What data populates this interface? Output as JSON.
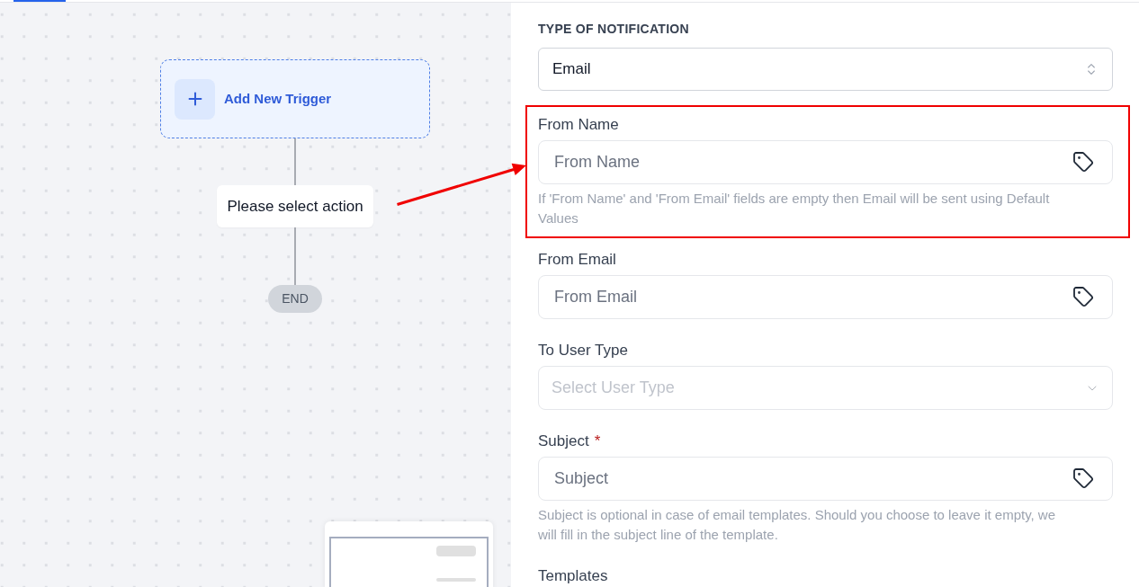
{
  "canvas": {
    "trigger_node": {
      "label": "Add New Trigger"
    },
    "action_node": {
      "label": "Please select action"
    },
    "end_node": {
      "label": "END"
    }
  },
  "panel": {
    "notification_type": {
      "label": "TYPE OF NOTIFICATION",
      "value": "Email"
    },
    "fields": [
      {
        "kind": "text",
        "label": "From Name",
        "placeholder": "From Name",
        "help": "If 'From Name' and 'From Email' fields are empty then Email will be sent using Default Values",
        "highlighted": true
      },
      {
        "kind": "text",
        "label": "From Email",
        "placeholder": "From Email",
        "highlighted": false
      },
      {
        "kind": "select",
        "label": "To User Type",
        "placeholder": "Select User Type",
        "highlighted": false
      },
      {
        "kind": "text",
        "label": "Subject",
        "required_mark": "*",
        "placeholder": "Subject",
        "help": "Subject is optional in case of email templates. Should you choose to leave it empty, we will fill in the subject line of the template.",
        "highlighted": false
      }
    ],
    "next_section": {
      "label": "Templates"
    }
  }
}
